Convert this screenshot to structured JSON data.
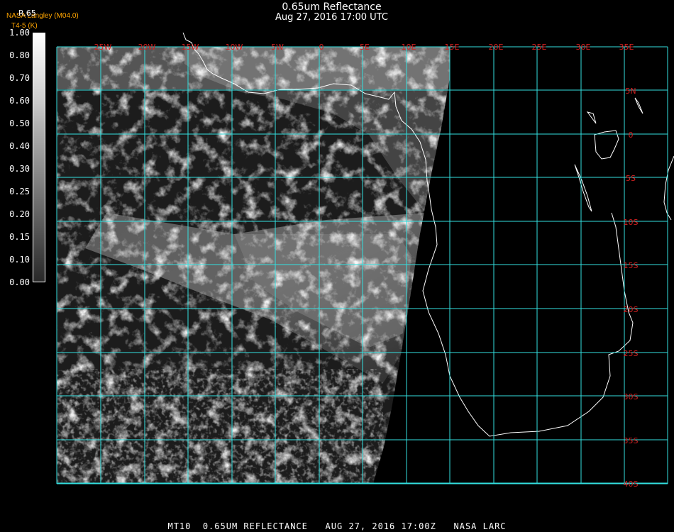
{
  "header": {
    "title": "0.65um Reflectance",
    "datetime": "Aug 27, 2016 17:00 UTC",
    "credit": "NASA Langley (M04.0)",
    "subcredit": "T4-5 (K)",
    "scale_top": "R.65"
  },
  "colorbar": {
    "labels": [
      "1.00",
      "0.80",
      "0.70",
      "0.60",
      "0.50",
      "0.40",
      "0.30",
      "0.25",
      "0.20",
      "0.15",
      "0.10",
      "0.00"
    ],
    "colors": [
      "#ffffff",
      "#eeeeee",
      "#dddddd",
      "#cccccc",
      "#b4b4b4",
      "#a0a0a0",
      "#8c8c8c",
      "#787878",
      "#646464",
      "#505050",
      "#3c3c3c",
      "#282828"
    ]
  },
  "map": {
    "lon_labels": [
      "25W",
      "20W",
      "15W",
      "10W",
      "5W",
      "0",
      "5E",
      "10E",
      "15E",
      "20E",
      "25E",
      "30E",
      "35E"
    ],
    "lat_labels": [
      "5N",
      "0",
      "5S",
      "10S",
      "15S",
      "20S",
      "25S",
      "30S",
      "35S",
      "40S"
    ],
    "grid_color": "#33e0e0",
    "label_color": "#d42020",
    "coast_color": "#ffffff"
  },
  "footer": {
    "text": "MT10  0.65UM REFLECTANCE   AUG 27, 2016 17:00Z   NASA LARC"
  }
}
